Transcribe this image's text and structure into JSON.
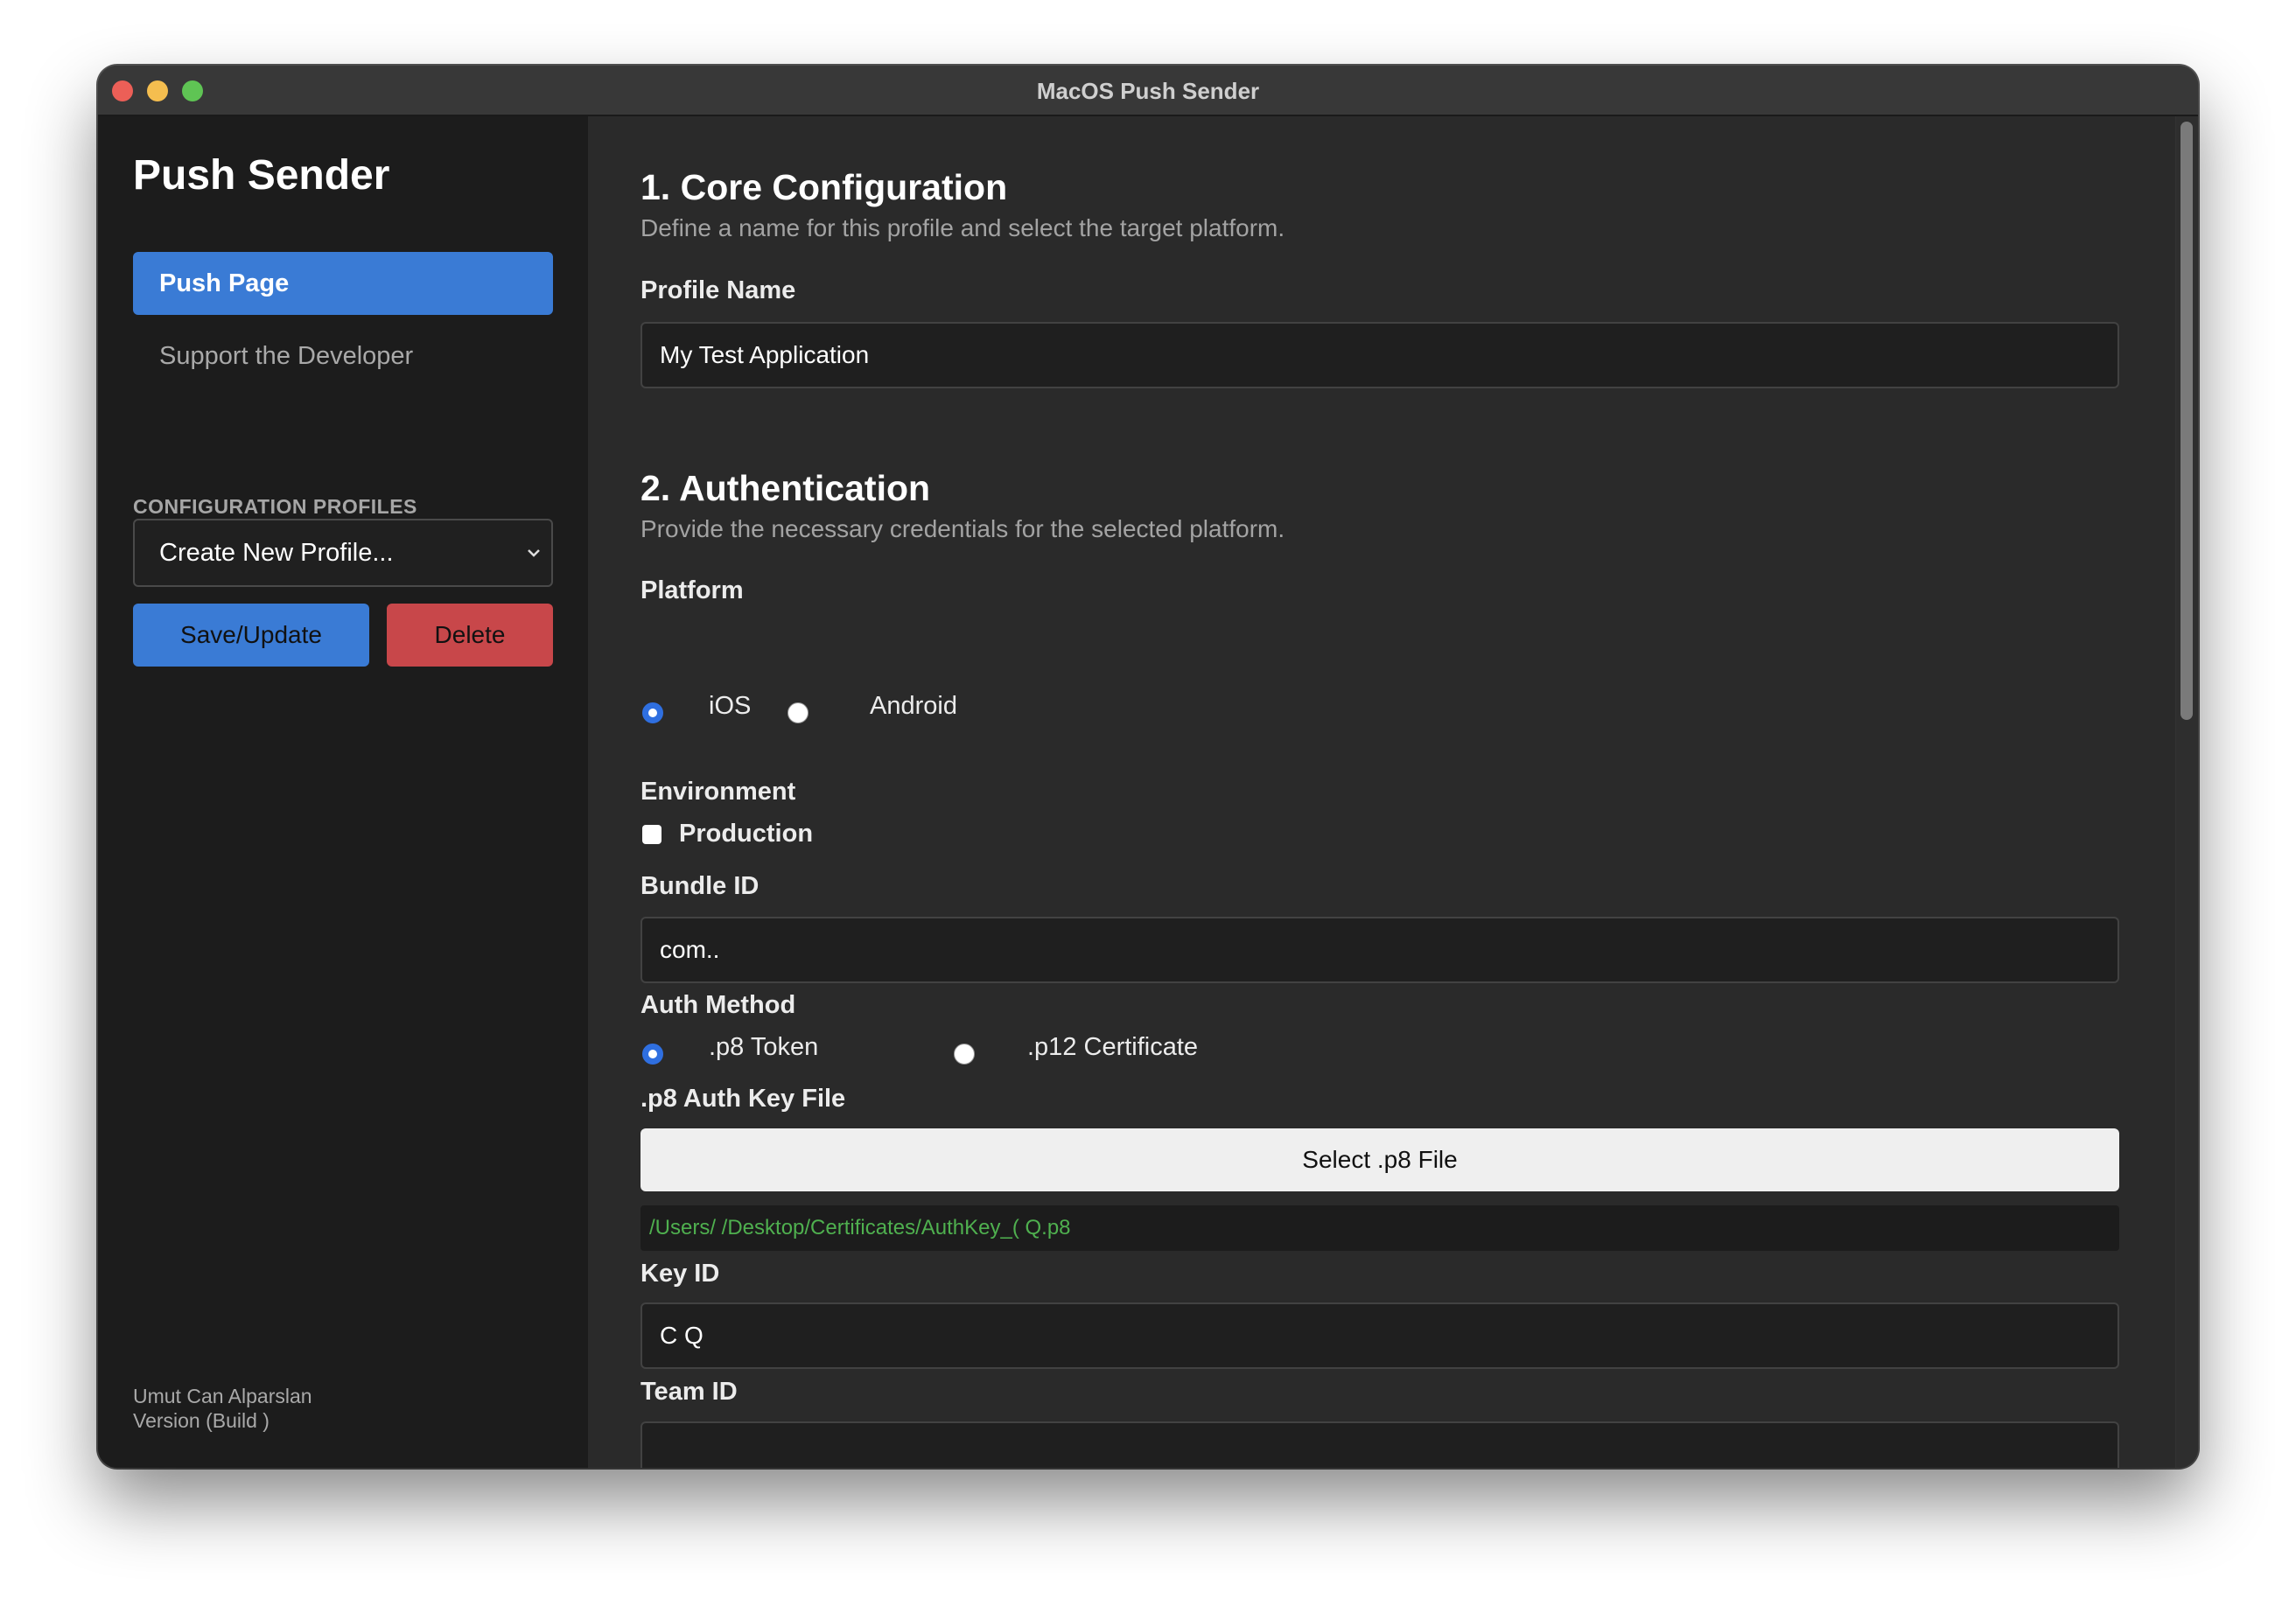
{
  "window": {
    "title": "MacOS Push Sender"
  },
  "sidebar": {
    "app_name": "Push Sender",
    "nav": [
      {
        "label": "Push Page",
        "active": true
      },
      {
        "label": "Support the Developer",
        "active": false
      }
    ],
    "profiles_caption": "CONFIGURATION PROFILES",
    "profile_select_value": "Create New Profile...",
    "save_label": "Save/Update",
    "delete_label": "Delete",
    "footer": {
      "author": "Umut Can Alparslan",
      "version": "Version  (Build )"
    }
  },
  "main": {
    "core": {
      "title": "1. Core Configuration",
      "description": "Define a name for this profile and select the target platform.",
      "profile_name_label": "Profile Name",
      "profile_name_value": "My Test Application"
    },
    "auth": {
      "title": "2. Authentication",
      "description": "Provide the necessary credentials for the selected platform.",
      "platform_label": "Platform",
      "platform_options": [
        {
          "label": "iOS",
          "selected": true
        },
        {
          "label": "Android",
          "selected": false
        }
      ],
      "environment_label": "Environment",
      "production_label": "Production",
      "production_checked": false,
      "bundle_id_label": "Bundle ID",
      "bundle_id_value": "com..",
      "auth_method_label": "Auth Method",
      "auth_method_options": [
        {
          "label": ".p8 Token",
          "selected": true
        },
        {
          "label": ".p12 Certificate",
          "selected": false
        }
      ],
      "p8_key_label": ".p8 Auth Key File",
      "select_p8_label": "Select .p8 File",
      "p8_path": "/Users/              /Desktop/Certificates/AuthKey_(                      Q.p8",
      "key_id_label": "Key ID",
      "key_id_value": "C               Q",
      "team_id_label": "Team ID",
      "team_id_value": ""
    }
  },
  "colors": {
    "accent": "#3a7bd5",
    "danger": "#c8474a",
    "path_text": "#4fb04f"
  }
}
